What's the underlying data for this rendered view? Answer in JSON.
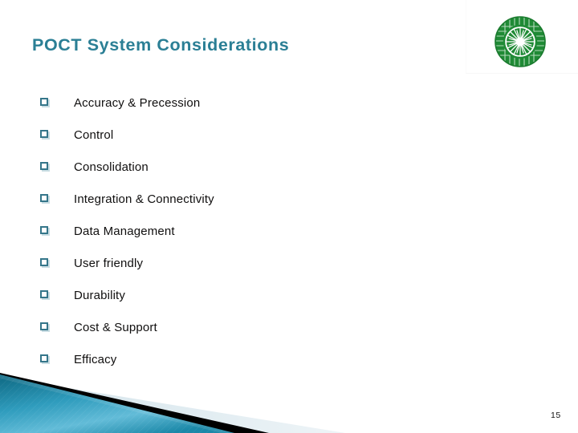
{
  "slide": {
    "title": "POCT System Considerations",
    "page_number": "15",
    "background_color": "#ffffff",
    "title_color": "#2b7f95",
    "bullet_color": "#35768a",
    "text_color": "#100f0f"
  },
  "logo": {
    "name": "green-circular-emblem-logo",
    "color": "#1f8a35",
    "description": "green concentric ring emblem with radiating sunburst center"
  },
  "bullets": [
    {
      "marker": "hollow-square-bullet",
      "label": "Accuracy & Precession"
    },
    {
      "marker": "hollow-square-bullet",
      "label": "Control"
    },
    {
      "marker": "hollow-square-bullet",
      "label": "Consolidation"
    },
    {
      "marker": "hollow-square-bullet",
      "label": "Integration & Connectivity"
    },
    {
      "marker": "hollow-square-bullet",
      "label": "Data Management"
    },
    {
      "marker": "hollow-square-bullet",
      "label": "User friendly"
    },
    {
      "marker": "hollow-square-bullet",
      "label": "Durability"
    },
    {
      "marker": "hollow-square-bullet",
      "label": "Cost & Support"
    },
    {
      "marker": "hollow-square-bullet",
      "label": "Efficacy"
    }
  ],
  "footer_art": {
    "blue_band_color_dark": "#0f6a85",
    "blue_band_color_light": "#59b4d4",
    "black_band_color": "#000000",
    "pale_band_color": "#dde8ee"
  }
}
